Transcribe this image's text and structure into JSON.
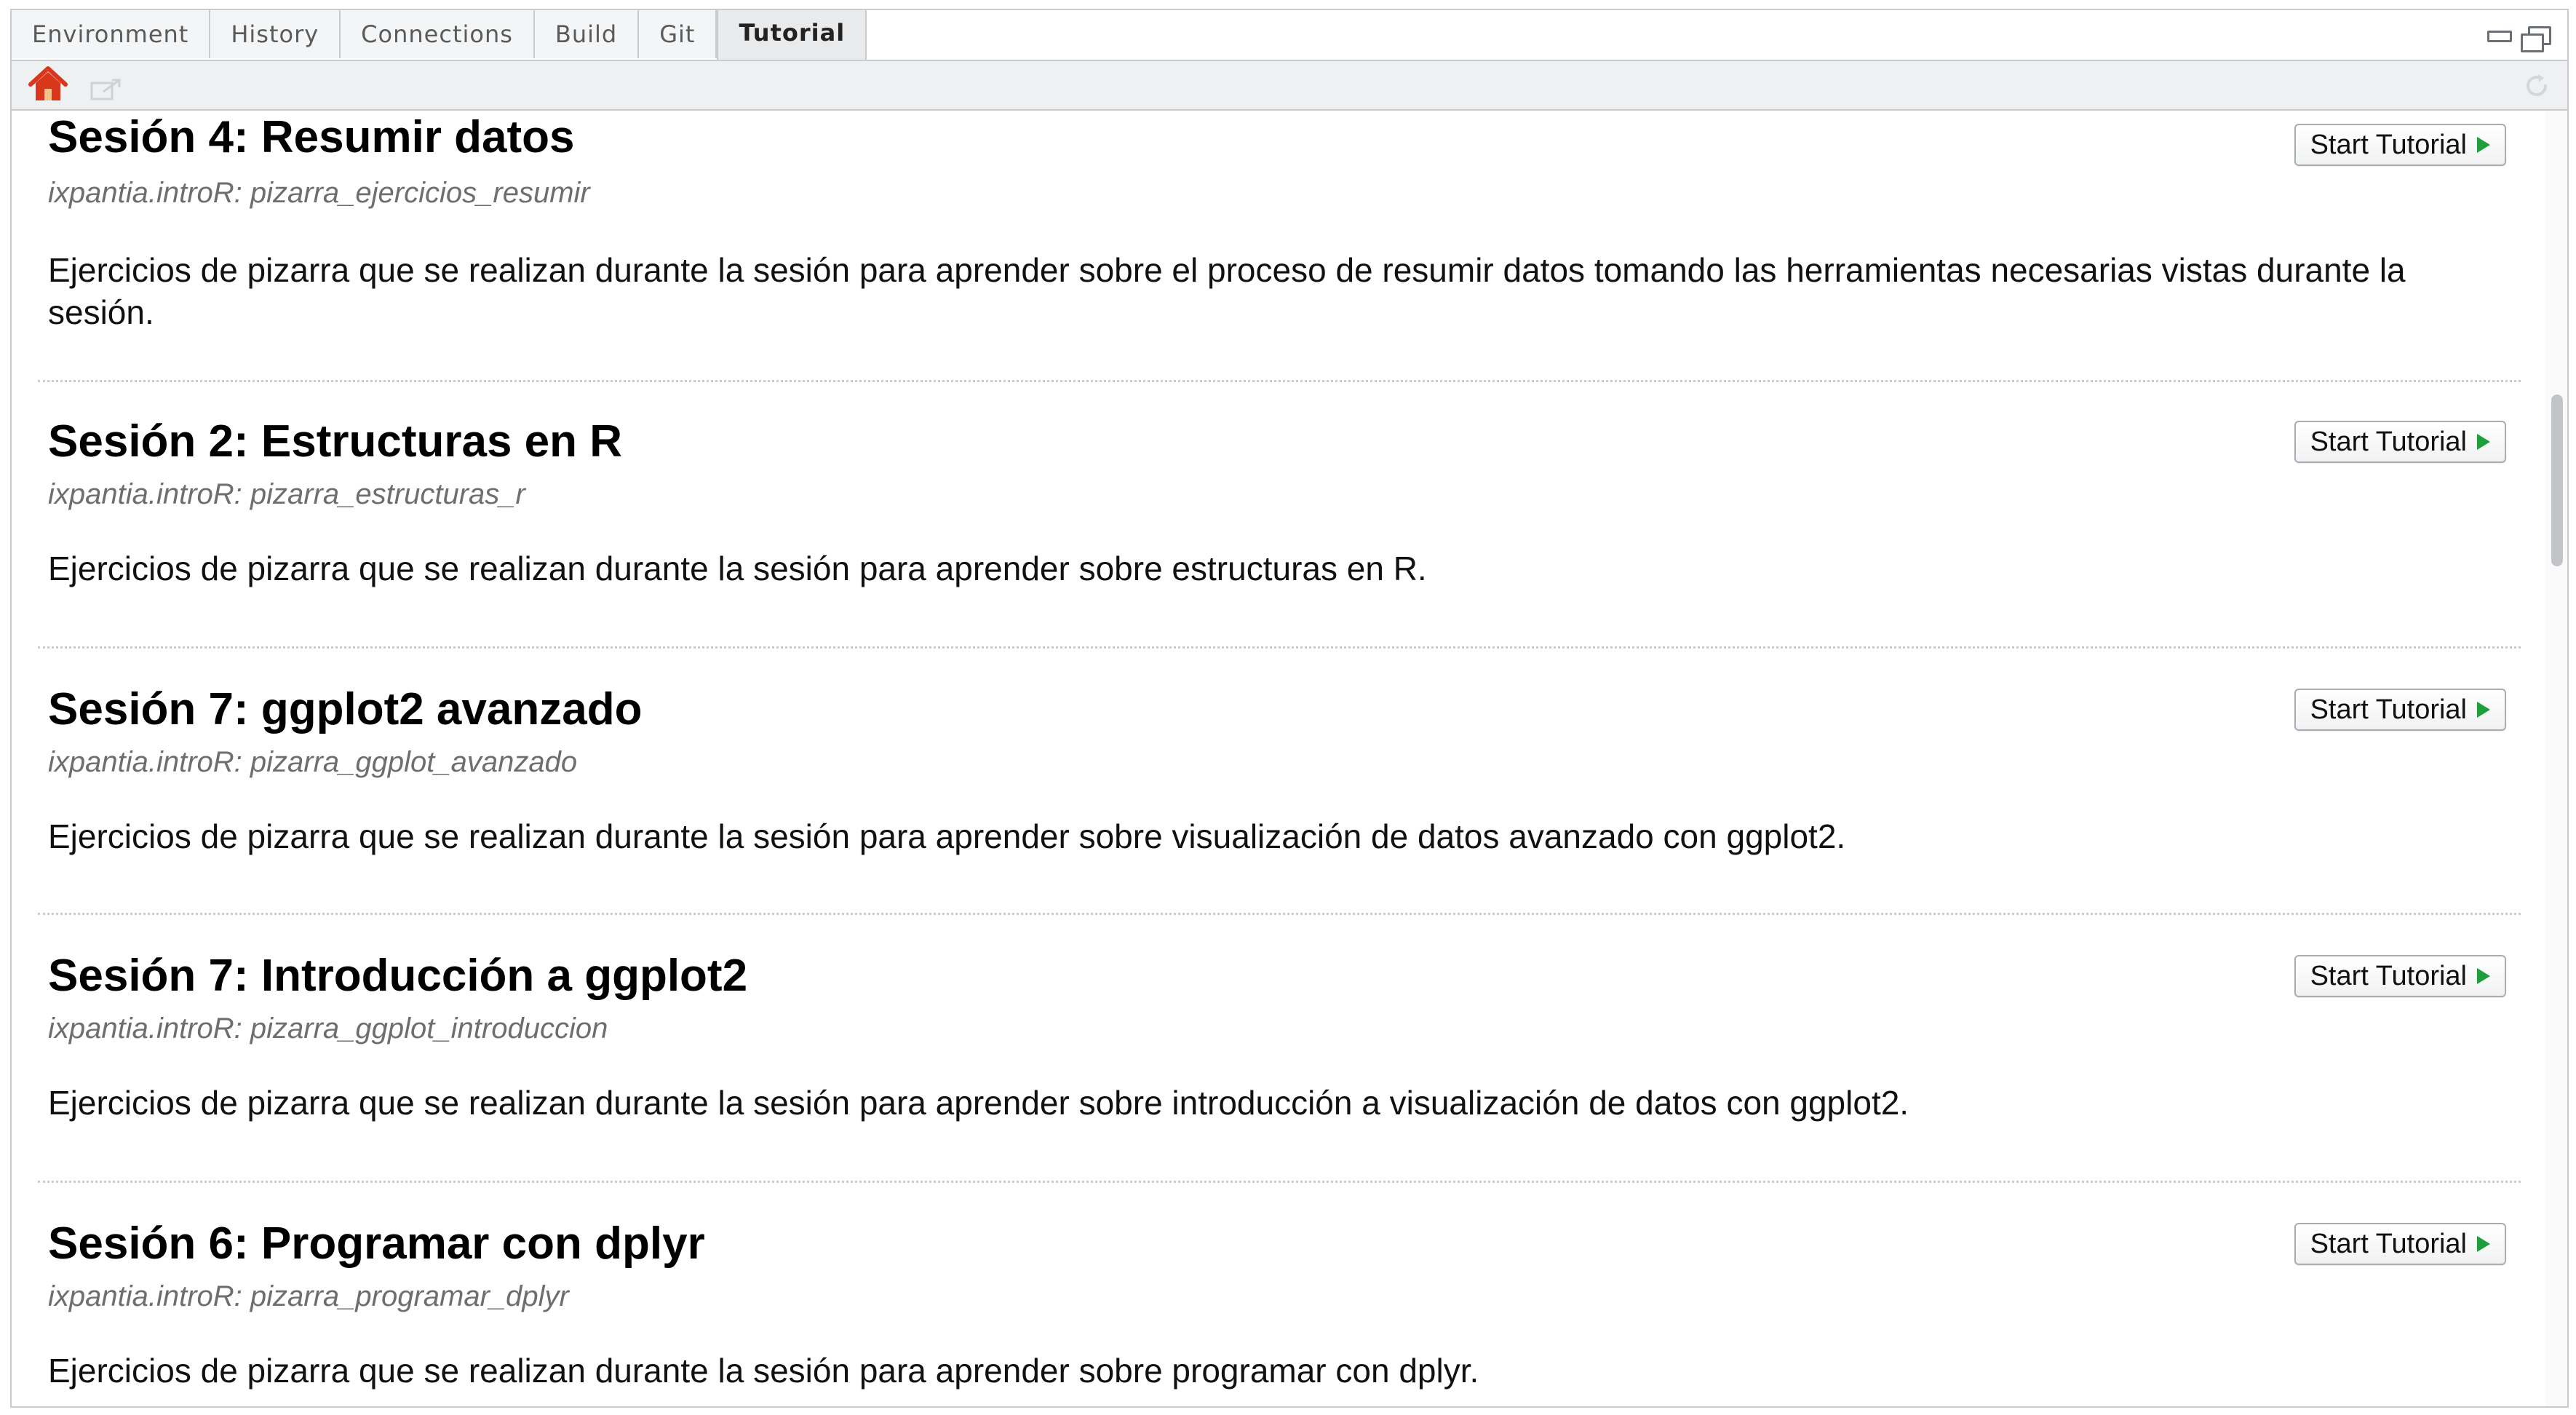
{
  "tabs": [
    "Environment",
    "History",
    "Connections",
    "Build",
    "Git",
    "Tutorial"
  ],
  "active_tab": "Tutorial",
  "tutorials": [
    {
      "title": "Sesión 4: Resumir datos",
      "package": "ixpantia.introR: pizarra_ejercicios_resumir",
      "description": "Ejercicios de pizarra que se realizan durante la sesión para aprender sobre el proceso de resumir datos tomando las herramientas necesarias vistas durante la sesión.",
      "button": "Start Tutorial"
    },
    {
      "title": "Sesión 2: Estructuras en R",
      "package": "ixpantia.introR: pizarra_estructuras_r",
      "description": "Ejercicios de pizarra que se realizan durante la sesión para aprender sobre estructuras en R.",
      "button": "Start Tutorial"
    },
    {
      "title": "Sesión 7: ggplot2 avanzado",
      "package": "ixpantia.introR: pizarra_ggplot_avanzado",
      "description": "Ejercicios de pizarra que se realizan durante la sesión para aprender sobre visualización de datos avanzado con ggplot2.",
      "button": "Start Tutorial"
    },
    {
      "title": "Sesión 7: Introducción a ggplot2",
      "package": "ixpantia.introR: pizarra_ggplot_introduccion",
      "description": "Ejercicios de pizarra que se realizan durante la sesión para aprender sobre introducción a visualización de datos con ggplot2.",
      "button": "Start Tutorial"
    },
    {
      "title": "Sesión 6: Programar con dplyr",
      "package": "ixpantia.introR: pizarra_programar_dplyr",
      "description": "Ejercicios de pizarra que se realizan durante la sesión para aprender sobre programar con dplyr.",
      "button": "Start Tutorial"
    }
  ],
  "colors": {
    "play_icon": "#1e9e3c",
    "home_icon": "#d9371c",
    "package_text": "#6e6e6e"
  },
  "icons": [
    "home-icon",
    "popout-icon",
    "refresh-icon",
    "minimize-icon",
    "maximize-icon",
    "play-icon"
  ]
}
